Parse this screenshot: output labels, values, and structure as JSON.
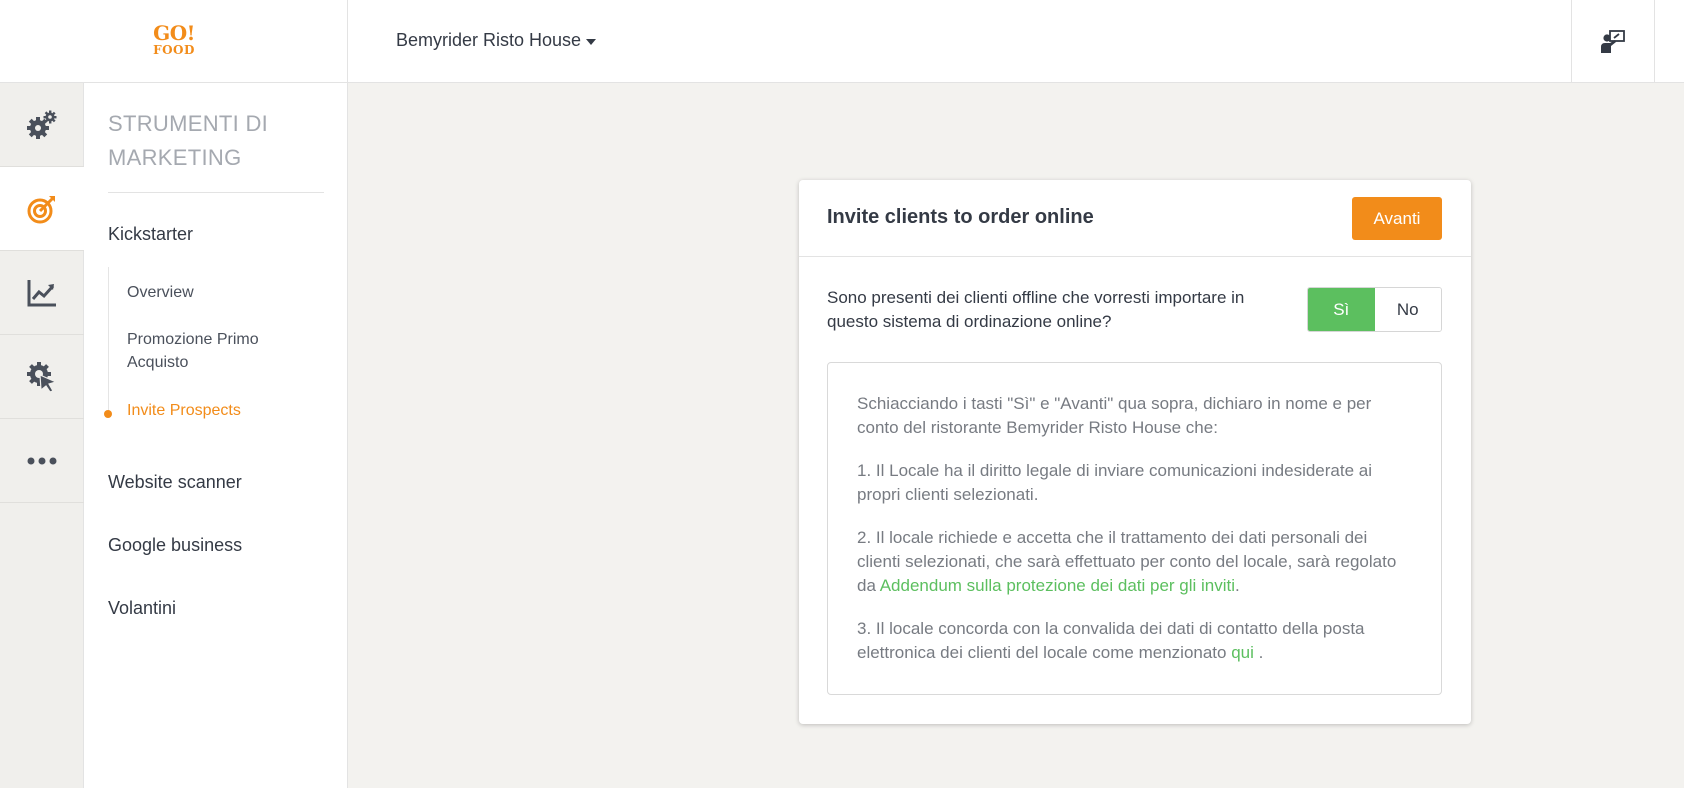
{
  "brand": {
    "logo_line1": "GO!",
    "logo_line2": "FOOD",
    "accent_color": "#f28c1a"
  },
  "header": {
    "restaurant_name": "Bemyrider Risto House"
  },
  "rail": [
    {
      "icon": "settings-gears-icon"
    },
    {
      "icon": "target-arrow-icon",
      "active": true
    },
    {
      "icon": "trend-chart-icon"
    },
    {
      "icon": "gear-cursor-icon"
    },
    {
      "icon": "more-dots-icon"
    }
  ],
  "sidemenu": {
    "title": "STRUMENTI DI MARKETING",
    "sections": {
      "kickstarter": "Kickstarter",
      "website_scanner": "Website scanner",
      "google_business": "Google business",
      "volantini": "Volantini"
    },
    "sub_items": {
      "overview": "Overview",
      "promozione": "Promozione Primo Acquisto",
      "invite": "Invite Prospects"
    },
    "active_item": "Invite Prospects"
  },
  "card": {
    "title": "Invite clients to order online",
    "next_button": "Avanti",
    "question": "Sono presenti dei clienti offline che vorresti importare in questo sistema di ordinazione online?",
    "toggle": {
      "yes": "Sì",
      "no": "No",
      "selected": "Sì",
      "selected_color": "#5cbf5f"
    },
    "terms": {
      "intro": "Schiacciando i tasti \"Sì\" e \"Avanti\" qua sopra, dichiaro in nome e per conto del ristorante Bemyrider Risto House che:",
      "point1": "1. Il Locale ha il diritto legale di inviare comunicazioni indesiderate ai propri clienti selezionati.",
      "point2_text": "2. Il locale richiede e accetta che il trattamento dei dati personali dei clienti selezionati, che sarà effettuato per conto del locale, sarà regolato da ",
      "point2_link": "Addendum sulla protezione dei dati per gli inviti",
      "point2_end": ".",
      "point3_text": "3. Il locale concorda con la convalida dei dati di contatto della posta elettronica dei clienti del locale come menzionato ",
      "point3_link": "qui",
      "point3_end": " ."
    }
  }
}
